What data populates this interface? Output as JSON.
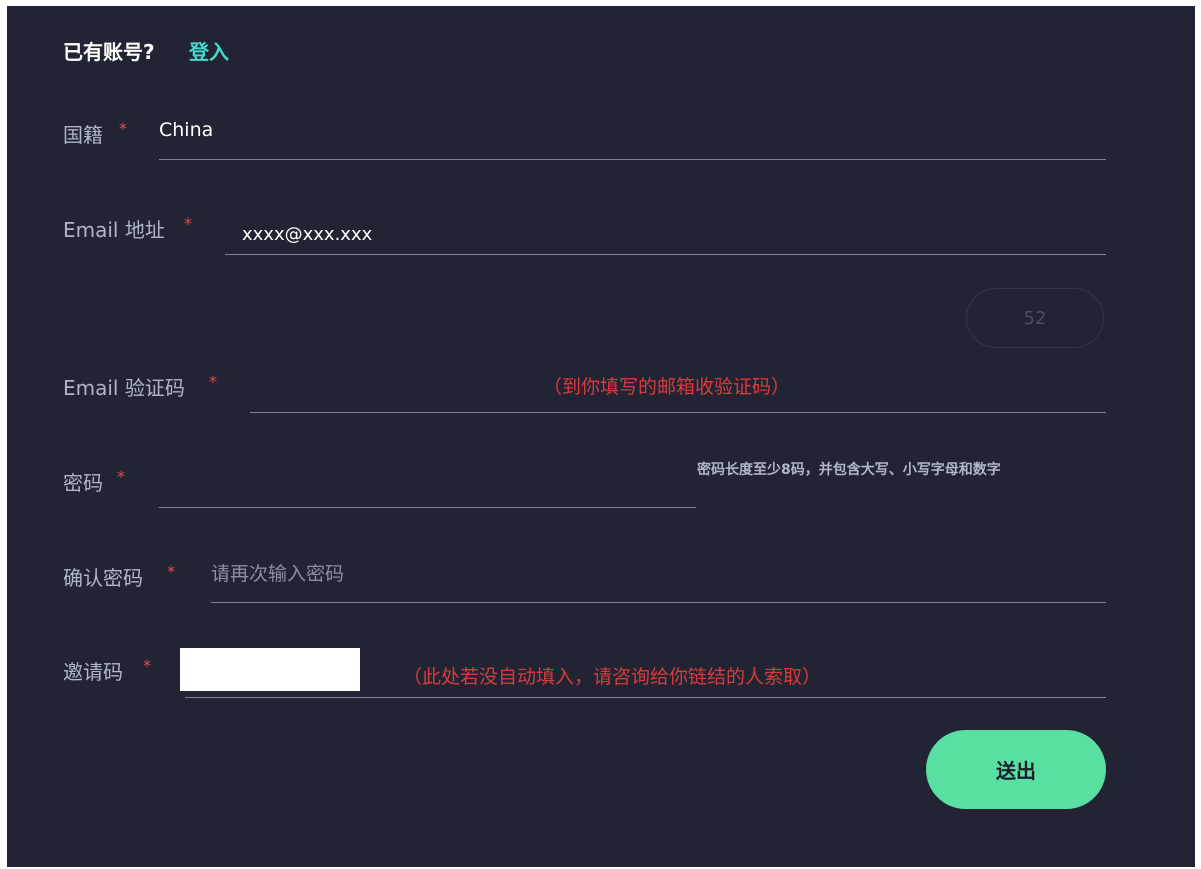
{
  "header": {
    "prompt": "已有账号?",
    "login_link": "登入"
  },
  "form": {
    "required_mark": "*",
    "nationality": {
      "label": "国籍",
      "value": "China"
    },
    "email": {
      "label": "Email 地址",
      "value": "xxxx@xxx.xxx"
    },
    "code_button": {
      "label": "52"
    },
    "email_code": {
      "label": "Email 验证码",
      "hint": "（到你填写的邮箱收验证码）"
    },
    "password": {
      "label": "密码",
      "hint": "密码长度至少8码，并包含大写、小写字母和数字"
    },
    "confirm_password": {
      "label": "确认密码",
      "placeholder": "请再次输入密码"
    },
    "invite_code": {
      "label": "邀请码",
      "hint": "（此处若没自动填入，请咨询给你链结的人索取）"
    },
    "submit": {
      "label": "送出"
    }
  },
  "colors": {
    "background": "#222433",
    "link": "#45d9cf",
    "required": "#e24b4b",
    "hint_red": "#d93a3a",
    "submit_button": "#5adfa2"
  }
}
